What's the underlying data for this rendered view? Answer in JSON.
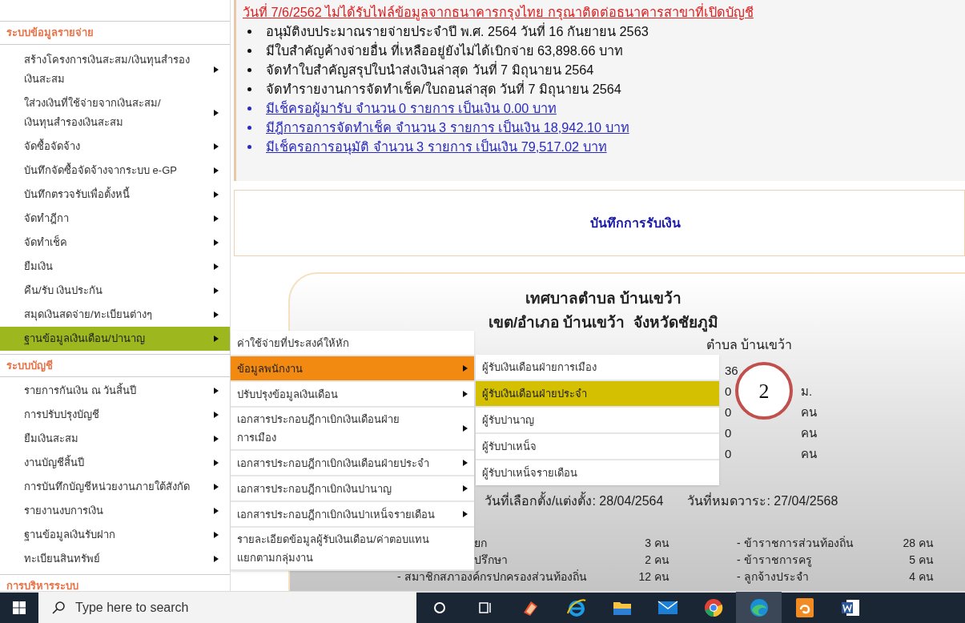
{
  "sidebar": {
    "sections": [
      {
        "title": "ระบบข้อมูลรายจ่าย",
        "items": [
          {
            "lines": [
              "สร้างโครงการเงินสะสม/เงินทุนสำรอง",
              "เงินสะสม"
            ],
            "has_submenu": true,
            "selected": false
          },
          {
            "lines": [
              "ใส่วงเงินที่ใช้จ่ายจากเงินสะสม/",
              "เงินทุนสำรองเงินสะสม"
            ],
            "has_submenu": true,
            "selected": false
          },
          {
            "label": "จัดซื้อจัดจ้าง",
            "has_submenu": true,
            "selected": false
          },
          {
            "label": "บันทึกจัดซื้อจัดจ้างจากระบบ e-GP",
            "has_submenu": true,
            "selected": false
          },
          {
            "label": "บันทึกตรวจรับเพื่อตั้งหนี้",
            "has_submenu": true,
            "selected": false
          },
          {
            "label": "จัดทำฎีกา",
            "has_submenu": true,
            "selected": false
          },
          {
            "label": "จัดทำเช็ค",
            "has_submenu": true,
            "selected": false
          },
          {
            "label": "ยืมเงิน",
            "has_submenu": true,
            "selected": false
          },
          {
            "label": "คืน/รับ เงินประกัน",
            "has_submenu": true,
            "selected": false
          },
          {
            "label": "สมุดเงินสดจ่าย/ทะเบียนต่างๆ",
            "has_submenu": true,
            "selected": false
          },
          {
            "label": "ฐานข้อมูลเงินเดือน/ปานาญ",
            "has_submenu": true,
            "selected": true
          }
        ]
      },
      {
        "title": "ระบบบัญชี",
        "items": [
          {
            "label": "รายการกันเงิน ณ วันสิ้นปี",
            "has_submenu": true,
            "selected": false
          },
          {
            "label": "การปรับปรุงบัญชี",
            "has_submenu": true,
            "selected": false
          },
          {
            "label": "ยืมเงินสะสม",
            "has_submenu": true,
            "selected": false
          },
          {
            "label": "งานบัญชีสิ้นปี",
            "has_submenu": true,
            "selected": false
          },
          {
            "label": "การบันทึกบัญชีหน่วยงานภายใต้สังกัด",
            "has_submenu": true,
            "selected": false
          },
          {
            "label": "รายงานงบการเงิน",
            "has_submenu": true,
            "selected": false
          },
          {
            "label": "ฐานข้อมูลเงินรับฝาก",
            "has_submenu": true,
            "selected": false
          },
          {
            "label": "ทะเบียนสินทรัพย์",
            "has_submenu": true,
            "selected": false
          }
        ]
      },
      {
        "title": "การบริหารระบบ"
      }
    ]
  },
  "notices": [
    {
      "kind": "alert",
      "text": "วันที่ 7/6/2562 ไม่ได้รับไฟล์ข้อมูลจากธนาคารกรุงไทย กรุณาติดต่อธนาคารสาขาที่เปิดบัญชี"
    },
    {
      "kind": "bullet",
      "text": "อนุมัติงบประมาณรายจ่ายประจำปี พ.ศ. 2564 วันที่ 16 กันยายน 2563"
    },
    {
      "kind": "bullet",
      "text": "มีใบสำคัญค้างจ่ายอื่น ที่เหลืออยู่ยังไม่ได้เบิกจ่าย 63,898.66 บาท"
    },
    {
      "kind": "bullet",
      "text": "จัดทำใบสำคัญสรุปใบนำส่งเงินล่าสุด วันที่ 7 มิถุนายน 2564"
    },
    {
      "kind": "bullet",
      "text": "จัดทำรายงานการจัดทำเช็ค/ใบถอนล่าสุด วันที่ 7 มิถุนายน 2564"
    },
    {
      "kind": "link",
      "text": "มีเช็ครอผู้มารับ จำนวน 0 รายการ เป็นเงิน 0.00 บาท"
    },
    {
      "kind": "link",
      "text": "มีฎีการอการจัดทำเช็ค จำนวน 3 รายการ เป็นเงิน 18,942.10 บาท"
    },
    {
      "kind": "link",
      "text": "มีเช็ครอการอนุมัติ จำนวน 3 รายการ เป็นเงิน 79,517.02 บาท"
    }
  ],
  "receipt_panel": {
    "title": "บันทึกการรับเงิน"
  },
  "org_card": {
    "name_lines": [
      "เทศบาลตำบล บ้านเขว้า",
      "เขต/อำเภอ บ้านเขว้า  จังหวัดชัยภูมิ"
    ],
    "address_fragment": "ตำบล บ้านเขว้า",
    "figures": [
      {
        "value": "36"
      },
      {
        "value": "0",
        "unit": "ม."
      },
      {
        "value": "0",
        "unit": "คน"
      },
      {
        "value": "0",
        "unit": "คน"
      },
      {
        "value": "0",
        "unit": "คน"
      }
    ],
    "term": {
      "elected": "วันที่เลือกตั้ง/แต่งตั้ง: 28/04/2564",
      "expires": "วันที่หมดวาระ: 27/04/2568"
    },
    "staff_rows": [
      {
        "left_label": "ยก",
        "left_count": "3 คน",
        "right_label": "- ข้าราชการส่วนท้องถิ่น",
        "right_count": "28 คน"
      },
      {
        "left_label": "ปรึกษา",
        "left_count": "2 คน",
        "right_label": "- ข้าราชการครู",
        "right_count": "5 คน"
      },
      {
        "left_label": "- สมาชิกสภาองค์กรปกครองส่วนท้องถิ่น",
        "left_count": "12 คน",
        "right_label": "- ลูกจ้างประจำ",
        "right_count": "4 คน"
      }
    ]
  },
  "submenu": {
    "items": [
      {
        "label": "ค่าใช้จ่ายที่ประสงค์ให้หัก",
        "has_submenu": false,
        "selected": false
      },
      {
        "label": "ข้อมูลพนักงาน",
        "has_submenu": true,
        "selected": true
      },
      {
        "label": "ปรับปรุงข้อมูลเงินเดือน",
        "has_submenu": true,
        "selected": false
      },
      {
        "lines": [
          "เอกสารประกอบฎีกาเบิกเงินเดือนฝ่าย",
          "การเมือง"
        ],
        "has_submenu": true,
        "selected": false
      },
      {
        "label": "เอกสารประกอบฎีกาเบิกเงินเดือนฝ่ายประจำ",
        "has_submenu": true,
        "selected": false
      },
      {
        "label": "เอกสารประกอบฎีกาเบิกเงินปานาญ",
        "has_submenu": true,
        "selected": false
      },
      {
        "label": "เอกสารประกอบฎีกาเบิกเงินปาเหน็จรายเดือน",
        "has_submenu": true,
        "selected": false
      },
      {
        "lines": [
          "รายละเอียดข้อมูลผู้รับเงินเดือน/ค่าตอบแทน",
          "แยกตามกลุ่มงาน"
        ],
        "has_submenu": false,
        "selected": false
      }
    ]
  },
  "submenu_2": {
    "items": [
      {
        "label": "ผู้รับเงินเดือนฝ่ายการเมือง",
        "selected": false
      },
      {
        "label": "ผู้รับเงินเดือนฝ่ายประจำ",
        "selected": true
      },
      {
        "label": "ผู้รับปานาญ",
        "selected": false
      },
      {
        "label": "ผู้รับปาเหน็จ",
        "selected": false
      },
      {
        "label": "ผู้รับปาเหน็จรายเดือน",
        "selected": false
      }
    ]
  },
  "annotation": {
    "number": "2"
  },
  "taskbar": {
    "search_placeholder": "Type here to search",
    "apps": [
      {
        "kind": "cortana",
        "selected": false
      },
      {
        "kind": "taskview",
        "selected": false
      },
      {
        "kind": "books",
        "selected": false
      },
      {
        "kind": "ie",
        "selected": false
      },
      {
        "kind": "folder",
        "selected": false
      },
      {
        "kind": "mail",
        "selected": false
      },
      {
        "kind": "chrome",
        "selected": false
      },
      {
        "kind": "edge",
        "selected": true
      },
      {
        "kind": "pdf",
        "selected": false
      },
      {
        "kind": "word",
        "selected": false
      }
    ]
  }
}
